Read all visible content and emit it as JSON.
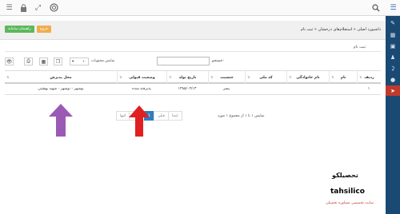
{
  "breadcrumb": "داشبورد اصلی « استعلام‌های درخشان « ثبت نام",
  "actions": {
    "exit_label": "خروج",
    "guide_label": "راهنمای سامانه"
  },
  "section_title": "ثبت نام",
  "toolbar": {
    "search_label": "جستجو:",
    "search_value": "",
    "page_size": "۱۰",
    "page_size_label": "نمایش محتویات"
  },
  "table": {
    "columns": [
      "ردیف",
      "نام",
      "نام خانوادگی",
      "کد ملی",
      "جنسیت",
      "تاریخ تولد",
      "وضعیت قبولی",
      "محل پذیرش"
    ],
    "rows": [
      [
        "۱",
        "",
        "",
        "",
        "پسر",
        "۱۳۸۵/۰۲/۱۳",
        "پذیرفته شده",
        "بوشهر - بوشهر - شهید بهشتی"
      ]
    ]
  },
  "pagination": {
    "first": "ابتدا",
    "prev": "قبلی",
    "current": "1",
    "next": "بعدی",
    "last": "انتها",
    "info": "نمایش ۱ تا ۱ از مجموع ۱ مورد"
  },
  "watermark": {
    "brand": "تحصیلکو",
    "url": "tahsilico",
    "tagline": "سایت تخصصی مشاوره تحصیلی"
  },
  "colors": {
    "rail": "#1a4a73",
    "accent_active": "#c0392b",
    "page_active": "#2e7ec0",
    "arrow_purple": "#9b59b6",
    "arrow_red": "#e02020"
  }
}
